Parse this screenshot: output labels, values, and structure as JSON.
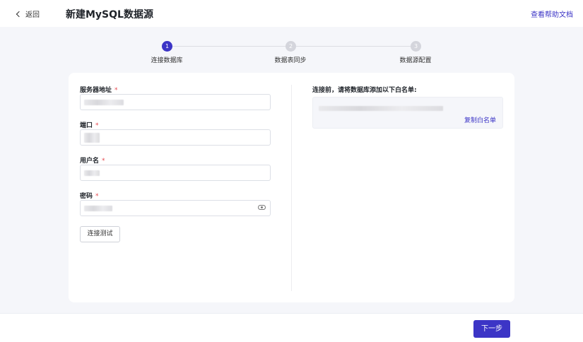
{
  "header": {
    "back_label": "返回",
    "title": "新建MySQL数据源",
    "help_link": "查看帮助文档"
  },
  "stepper": {
    "steps": [
      {
        "number": "1",
        "label": "连接数据库",
        "state": "active"
      },
      {
        "number": "2",
        "label": "数据表同步",
        "state": "todo"
      },
      {
        "number": "3",
        "label": "数据源配置",
        "state": "todo"
      }
    ]
  },
  "form": {
    "host": {
      "label": "服务器地址",
      "required_mark": "*"
    },
    "port": {
      "label": "端口",
      "required_mark": "*"
    },
    "username": {
      "label": "用户名",
      "required_mark": "*"
    },
    "password": {
      "label": "密码",
      "required_mark": "*"
    },
    "test_button": "连接测试"
  },
  "whitelist": {
    "title": "连接前，请将数据库添加以下白名单:",
    "copy_label": "复制白名单"
  },
  "footer": {
    "next_button": "下一步"
  },
  "colors": {
    "primary": "#3c35c6",
    "required": "#e5484d",
    "background": "#f5f6fa"
  }
}
